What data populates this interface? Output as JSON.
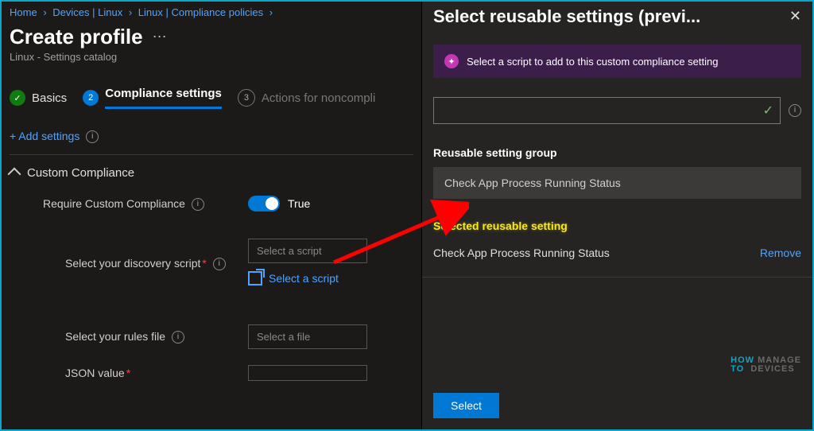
{
  "breadcrumbs": [
    "Home",
    "Devices | Linux",
    "Linux | Compliance policies"
  ],
  "page": {
    "title": "Create profile",
    "subtitle": "Linux - Settings catalog"
  },
  "steps": {
    "done": "Basics",
    "active": "Compliance settings",
    "next_num": "3",
    "next": "Actions for noncompli"
  },
  "add_settings": "+ Add settings",
  "section": "Custom Compliance",
  "fields": {
    "require": "Require Custom Compliance",
    "toggle_value": "True",
    "discovery": "Select your discovery script",
    "discovery_placeholder": "Select a script",
    "select_script_link": "Select a script",
    "rules": "Select your rules file",
    "rules_placeholder": "Select a file",
    "json": "JSON value"
  },
  "pane_title": "Select reusable settings (previ...",
  "purple_msg": "Select a script to add to this custom compliance setting",
  "group_label": "Reusable setting group",
  "group_item": "Check App Process Running Status",
  "selected_label": "Selected reusable setting",
  "selected_item": "Check App Process Running Status",
  "remove": "Remove",
  "select_btn": "Select",
  "watermark": {
    "l1": "HOW",
    "l2": "MANAGE",
    "l3": "TO",
    "l4": "DEVICES"
  }
}
